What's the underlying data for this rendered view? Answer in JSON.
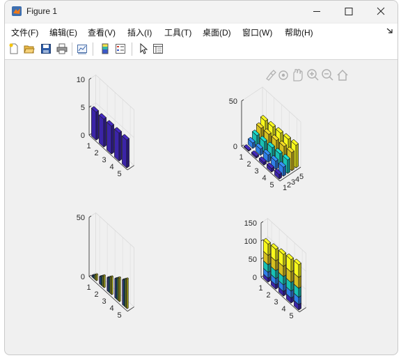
{
  "window": {
    "title": "Figure 1"
  },
  "menu": {
    "items": [
      "文件(F)",
      "编辑(E)",
      "查看(V)",
      "插入(I)",
      "工具(T)",
      "桌面(D)",
      "窗口(W)",
      "帮助(H)"
    ]
  },
  "toolbar": {
    "icons": [
      "new-figure-icon",
      "open-icon",
      "save-icon",
      "print-icon",
      "link-plot-icon",
      "colorbar-icon",
      "legend-icon",
      "edit-plot-icon",
      "property-inspector-icon"
    ]
  },
  "axes_toolbar": {
    "icons": [
      "brush-icon",
      "datatip-icon",
      "pan-icon",
      "zoom-in-icon",
      "zoom-out-icon",
      "home-icon"
    ]
  },
  "colors": {
    "series": [
      "#3b24a8",
      "#2f7fe8",
      "#18c0b4",
      "#d6c020",
      "#f8f81c"
    ]
  },
  "chart_data": [
    {
      "type": "bar",
      "style": "bar3 detached",
      "categories": [
        "1",
        "2",
        "3",
        "4",
        "5"
      ],
      "series": [
        {
          "values": [
            5,
            5,
            5,
            5,
            5
          ]
        }
      ],
      "zticks": [
        "0",
        "5",
        "10"
      ],
      "ylim": [
        0,
        10
      ],
      "grid": true
    },
    {
      "type": "bar",
      "style": "bar3 detached, 5 series in depth",
      "categories": [
        "1",
        "2",
        "3",
        "4",
        "5"
      ],
      "depth_categories": [
        "1",
        "2",
        "3",
        "4",
        "5"
      ],
      "series": [
        {
          "values": [
            1,
            2,
            3,
            4,
            5
          ]
        },
        {
          "values": [
            6,
            7,
            8,
            9,
            10
          ]
        },
        {
          "values": [
            11,
            12,
            13,
            14,
            15
          ]
        },
        {
          "values": [
            16,
            17,
            18,
            19,
            20
          ]
        },
        {
          "values": [
            21,
            22,
            23,
            24,
            25
          ]
        }
      ],
      "zticks": [
        "0",
        "50"
      ],
      "grid": true
    },
    {
      "type": "bar",
      "style": "bar3 grouped",
      "categories": [
        "1",
        "2",
        "3",
        "4",
        "5"
      ],
      "series": [
        {
          "values": [
            1,
            6,
            11,
            16,
            21
          ]
        },
        {
          "values": [
            2,
            7,
            12,
            17,
            22
          ]
        },
        {
          "values": [
            3,
            8,
            13,
            18,
            23
          ]
        },
        {
          "values": [
            4,
            9,
            14,
            19,
            24
          ]
        },
        {
          "values": [
            5,
            10,
            15,
            20,
            25
          ]
        }
      ],
      "zticks": [
        "0",
        "50"
      ],
      "grid": true
    },
    {
      "type": "bar",
      "style": "bar3 stacked",
      "categories": [
        "1",
        "2",
        "3",
        "4",
        "5"
      ],
      "series": [
        {
          "values": [
            11,
            12,
            13,
            14,
            15
          ]
        },
        {
          "values": [
            16,
            17,
            18,
            19,
            20
          ]
        },
        {
          "values": [
            21,
            22,
            23,
            24,
            25
          ]
        },
        {
          "values": [
            26,
            27,
            28,
            29,
            30
          ]
        },
        {
          "values": [
            31,
            32,
            33,
            34,
            35
          ]
        }
      ],
      "zticks": [
        "0",
        "50",
        "100",
        "150"
      ],
      "ylim": [
        0,
        150
      ],
      "grid": true
    }
  ]
}
